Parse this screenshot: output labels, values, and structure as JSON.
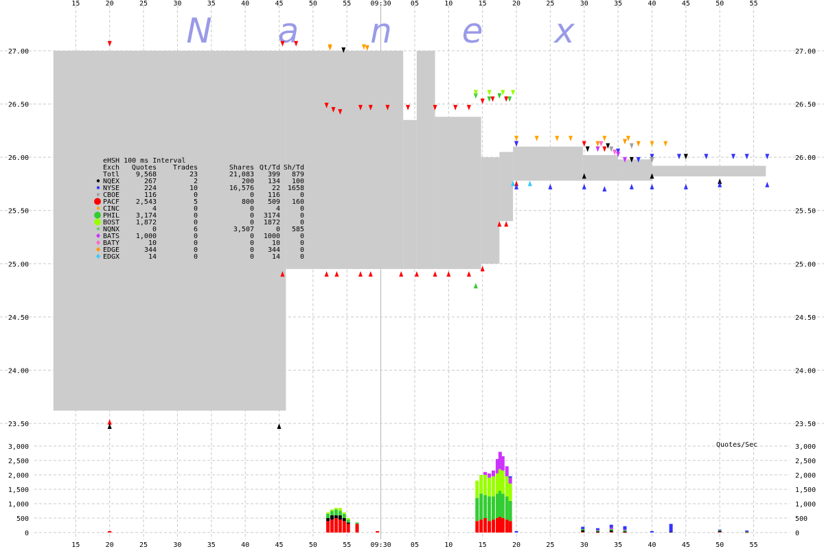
{
  "colors": {
    "background": "#ffffff",
    "grid": "#c8c8c8",
    "spread": "#cccccc",
    "watermark": "#9a9ae8",
    "NQEX": "#000000",
    "NYSE": "#3333ff",
    "CBOE": "#a0a0a0",
    "PACF": "#ff0000",
    "CINC": "#ffa500",
    "PHIL": "#33cc33",
    "BOST": "#99ff00",
    "NQNX": "#66cc66",
    "BATS": "#cc33ff",
    "BATY": "#ff66cc",
    "EDGE": "#ff9900",
    "EDGX": "#33ccff"
  },
  "watermark": [
    "N",
    "a",
    "n",
    "e",
    "x"
  ],
  "chart_data": [
    {
      "type": "area",
      "title": "",
      "xlabel": "",
      "ylabel": "",
      "x_unit": "minute",
      "x_ticks": [
        "15",
        "20",
        "25",
        "30",
        "35",
        "40",
        "45",
        "50",
        "55",
        "09:30",
        "05",
        "10",
        "15",
        "20",
        "25",
        "30",
        "35",
        "40",
        "45",
        "50",
        "55"
      ],
      "x_tick_minutes": [
        -15,
        -10,
        -5,
        0,
        5,
        10,
        15,
        20,
        25,
        30,
        35,
        40,
        45,
        50,
        55,
        60,
        65,
        70,
        75,
        80,
        85
      ],
      "x_range": [
        -20.3,
        89.5
      ],
      "highlight_time": "09:30",
      "highlight_minute": 30,
      "y_ticks": [
        "23.50",
        "24.00",
        "24.50",
        "25.00",
        "25.50",
        "26.00",
        "26.50",
        "27.00"
      ],
      "ylim": [
        23.5,
        27.0
      ],
      "grid": true,
      "spread": [
        {
          "x0": -18.3,
          "x1": 16.0,
          "low": 23.62,
          "high": 27.0
        },
        {
          "x0": 16.0,
          "x1": 33.3,
          "low": 24.95,
          "high": 27.0
        },
        {
          "x0": 33.3,
          "x1": 35.3,
          "low": 24.95,
          "high": 26.35
        },
        {
          "x0": 35.3,
          "x1": 38.0,
          "low": 24.95,
          "high": 27.0
        },
        {
          "x0": 38.0,
          "x1": 44.8,
          "low": 24.95,
          "high": 26.38
        },
        {
          "x0": 44.8,
          "x1": 47.5,
          "low": 25.0,
          "high": 26.0
        },
        {
          "x0": 47.5,
          "x1": 49.5,
          "low": 25.4,
          "high": 26.05
        },
        {
          "x0": 49.5,
          "x1": 59.8,
          "low": 25.78,
          "high": 26.1
        },
        {
          "x0": 59.8,
          "x1": 65.0,
          "low": 25.78,
          "high": 26.02
        },
        {
          "x0": 65.0,
          "x1": 70.0,
          "low": 25.78,
          "high": 25.98
        },
        {
          "x0": 70.0,
          "x1": 86.8,
          "low": 25.82,
          "high": 25.92
        }
      ],
      "series": [
        {
          "name": "PACF",
          "kind": "bid",
          "values": [
            [
              -10,
              23.54
            ],
            [
              15.5,
              24.93
            ],
            [
              22,
              24.93
            ],
            [
              23.5,
              24.93
            ],
            [
              27,
              24.93
            ],
            [
              28.5,
              24.93
            ],
            [
              33,
              24.93
            ],
            [
              35.3,
              24.93
            ],
            [
              38,
              24.93
            ],
            [
              40,
              24.93
            ],
            [
              43,
              24.93
            ],
            [
              45,
              24.98
            ],
            [
              47.5,
              25.4
            ],
            [
              48.5,
              25.4
            ],
            [
              50,
              25.78
            ]
          ]
        },
        {
          "name": "PACF",
          "kind": "ask",
          "values": [
            [
              -10,
              27.04
            ],
            [
              15.5,
              27.04
            ],
            [
              17.5,
              27.04
            ],
            [
              22,
              26.46
            ],
            [
              23,
              26.42
            ],
            [
              24,
              26.4
            ],
            [
              27,
              26.44
            ],
            [
              28.5,
              26.44
            ],
            [
              31,
              26.44
            ],
            [
              34,
              26.44
            ],
            [
              38,
              26.44
            ],
            [
              41,
              26.44
            ],
            [
              43,
              26.44
            ],
            [
              45,
              26.5
            ],
            [
              46.5,
              26.52
            ],
            [
              48.5,
              26.52
            ],
            [
              50,
              26.1
            ],
            [
              60,
              26.1
            ],
            [
              63,
              26.05
            ]
          ]
        },
        {
          "name": "NQEX",
          "kind": "bid",
          "values": [
            [
              -10,
              23.5
            ],
            [
              15,
              23.5
            ],
            [
              60,
              25.85
            ],
            [
              70,
              25.85
            ],
            [
              80,
              25.8
            ]
          ]
        },
        {
          "name": "NQEX",
          "kind": "ask",
          "values": [
            [
              24.5,
              26.98
            ],
            [
              60.5,
              26.05
            ],
            [
              63.5,
              26.08
            ],
            [
              67,
              25.95
            ],
            [
              70,
              25.95
            ],
            [
              75,
              25.98
            ]
          ]
        },
        {
          "name": "NYSE",
          "kind": "bid",
          "values": [
            [
              50,
              25.75
            ],
            [
              55,
              25.75
            ],
            [
              60,
              25.75
            ],
            [
              63,
              25.73
            ],
            [
              67,
              25.75
            ],
            [
              70,
              25.75
            ],
            [
              75,
              25.75
            ],
            [
              80,
              25.77
            ],
            [
              87,
              25.77
            ]
          ]
        },
        {
          "name": "NYSE",
          "kind": "ask",
          "values": [
            [
              50,
              26.1
            ],
            [
              65,
              26.03
            ],
            [
              68,
              25.95
            ],
            [
              70,
              25.98
            ],
            [
              74,
              25.98
            ],
            [
              78,
              25.98
            ],
            [
              82,
              25.98
            ],
            [
              84,
              25.98
            ],
            [
              87,
              25.98
            ]
          ]
        },
        {
          "name": "PHIL",
          "kind": "ask",
          "values": [
            [
              44,
              26.55
            ],
            [
              46,
              26.52
            ],
            [
              47.5,
              26.55
            ],
            [
              49,
              26.52
            ]
          ]
        },
        {
          "name": "PHIL",
          "kind": "bid",
          "values": [
            [
              44,
              24.82
            ]
          ]
        },
        {
          "name": "BOST",
          "kind": "ask",
          "values": [
            [
              44,
              26.58
            ],
            [
              46,
              26.58
            ],
            [
              48,
              26.58
            ],
            [
              49.5,
              26.58
            ]
          ]
        },
        {
          "name": "CINC",
          "kind": "ask",
          "values": [
            [
              22.5,
              27.01
            ],
            [
              27.5,
              27.01
            ],
            [
              50,
              26.15
            ],
            [
              53,
              26.15
            ],
            [
              56,
              26.15
            ],
            [
              58,
              26.15
            ],
            [
              63,
              26.15
            ],
            [
              66.5,
              26.15
            ],
            [
              70,
              26.1
            ],
            [
              72,
              26.1
            ]
          ]
        },
        {
          "name": "BATS",
          "kind": "ask",
          "values": [
            [
              62,
              26.05
            ],
            [
              65,
              26.0
            ],
            [
              66,
              25.95
            ]
          ]
        },
        {
          "name": "BATY",
          "kind": "ask",
          "values": [
            [
              62.5,
              26.1
            ],
            [
              64.5,
              26.02
            ]
          ]
        },
        {
          "name": "CBOE",
          "kind": "ask",
          "values": [
            [
              64,
              26.05
            ],
            [
              67,
              26.08
            ],
            [
              70,
              25.95
            ]
          ]
        },
        {
          "name": "EDGE",
          "kind": "ask",
          "values": [
            [
              22.5,
              27.0
            ],
            [
              28,
              27.0
            ],
            [
              62,
              26.1
            ],
            [
              66,
              26.12
            ],
            [
              68,
              26.1
            ]
          ]
        },
        {
          "name": "EDGX",
          "kind": "bid",
          "values": [
            [
              49.5,
              25.78
            ],
            [
              52,
              25.78
            ]
          ]
        }
      ]
    },
    {
      "type": "bar",
      "title": "Quotes/Sec",
      "xlabel": "",
      "ylabel": "",
      "x_unit": "minute",
      "y_ticks": [
        "0",
        "500",
        "1,000",
        "1,500",
        "2,000",
        "2,500",
        "3,000"
      ],
      "ylim": [
        0,
        3000
      ],
      "grid": true,
      "stack_order": [
        "PACF",
        "NQEX",
        "PHIL",
        "BOST",
        "BATS",
        "NYSE"
      ],
      "bins": [
        {
          "x": -10,
          "PACF": 50,
          "NQEX": 0,
          "PHIL": 0,
          "BOST": 0,
          "BATS": 0,
          "NYSE": 0
        },
        {
          "x": 22.2,
          "PACF": 400,
          "NQEX": 100,
          "PHIL": 150,
          "BOST": 50,
          "BATS": 0,
          "NYSE": 0
        },
        {
          "x": 22.8,
          "PACF": 450,
          "NQEX": 150,
          "PHIL": 150,
          "BOST": 50,
          "BATS": 0,
          "NYSE": 0
        },
        {
          "x": 23.4,
          "PACF": 500,
          "NQEX": 100,
          "PHIL": 200,
          "BOST": 50,
          "BATS": 0,
          "NYSE": 0
        },
        {
          "x": 24.0,
          "PACF": 450,
          "NQEX": 150,
          "PHIL": 150,
          "BOST": 100,
          "BATS": 0,
          "NYSE": 0
        },
        {
          "x": 24.6,
          "PACF": 400,
          "NQEX": 100,
          "PHIL": 150,
          "BOST": 50,
          "BATS": 0,
          "NYSE": 0
        },
        {
          "x": 25.2,
          "PACF": 300,
          "NQEX": 50,
          "PHIL": 100,
          "BOST": 50,
          "BATS": 0,
          "NYSE": 0
        },
        {
          "x": 26.5,
          "PACF": 300,
          "NQEX": 0,
          "PHIL": 50,
          "BOST": 0,
          "BATS": 0,
          "NYSE": 0
        },
        {
          "x": 29.5,
          "PACF": 50,
          "NQEX": 0,
          "PHIL": 0,
          "BOST": 0,
          "BATS": 0,
          "NYSE": 0
        },
        {
          "x": 44.2,
          "PACF": 400,
          "NQEX": 0,
          "PHIL": 800,
          "BOST": 600,
          "BATS": 0,
          "NYSE": 0
        },
        {
          "x": 44.8,
          "PACF": 450,
          "NQEX": 0,
          "PHIL": 900,
          "BOST": 650,
          "BATS": 0,
          "NYSE": 0
        },
        {
          "x": 45.4,
          "PACF": 500,
          "NQEX": 0,
          "PHIL": 800,
          "BOST": 700,
          "BATS": 100,
          "NYSE": 0
        },
        {
          "x": 46.0,
          "PACF": 400,
          "NQEX": 0,
          "PHIL": 850,
          "BOST": 650,
          "BATS": 150,
          "NYSE": 0
        },
        {
          "x": 46.6,
          "PACF": 450,
          "NQEX": 0,
          "PHIL": 800,
          "BOST": 700,
          "BATS": 200,
          "NYSE": 0
        },
        {
          "x": 47.2,
          "PACF": 500,
          "NQEX": 0,
          "PHIL": 850,
          "BOST": 700,
          "BATS": 500,
          "NYSE": 0
        },
        {
          "x": 47.6,
          "PACF": 550,
          "NQEX": 0,
          "PHIL": 900,
          "BOST": 750,
          "BATS": 600,
          "NYSE": 0
        },
        {
          "x": 48.0,
          "PACF": 500,
          "NQEX": 0,
          "PHIL": 850,
          "BOST": 800,
          "BATS": 500,
          "NYSE": 0
        },
        {
          "x": 48.6,
          "PACF": 450,
          "NQEX": 0,
          "PHIL": 800,
          "BOST": 700,
          "BATS": 350,
          "NYSE": 0
        },
        {
          "x": 49.1,
          "PACF": 400,
          "NQEX": 0,
          "PHIL": 700,
          "BOST": 600,
          "BATS": 200,
          "NYSE": 50
        },
        {
          "x": 50.0,
          "PACF": 0,
          "NQEX": 0,
          "PHIL": 0,
          "BOST": 0,
          "BATS": 0,
          "NYSE": 50
        },
        {
          "x": 59.8,
          "PACF": 20,
          "NQEX": 60,
          "PHIL": 40,
          "BOST": 0,
          "BATS": 0,
          "NYSE": 80
        },
        {
          "x": 62.0,
          "PACF": 10,
          "NQEX": 30,
          "PHIL": 30,
          "BOST": 0,
          "BATS": 20,
          "NYSE": 60
        },
        {
          "x": 64.0,
          "PACF": 20,
          "NQEX": 50,
          "PHIL": 50,
          "BOST": 0,
          "BATS": 50,
          "NYSE": 100
        },
        {
          "x": 66.0,
          "PACF": 10,
          "NQEX": 30,
          "PHIL": 40,
          "BOST": 0,
          "BATS": 20,
          "NYSE": 120
        },
        {
          "x": 70.0,
          "PACF": 0,
          "NQEX": 0,
          "PHIL": 0,
          "BOST": 0,
          "BATS": 0,
          "NYSE": 50
        },
        {
          "x": 72.8,
          "PACF": 0,
          "NQEX": 20,
          "PHIL": 0,
          "BOST": 0,
          "BATS": 0,
          "NYSE": 280
        },
        {
          "x": 80.0,
          "PACF": 20,
          "NQEX": 30,
          "PHIL": 20,
          "BOST": 0,
          "BATS": 0,
          "NYSE": 30
        },
        {
          "x": 84.0,
          "PACF": 10,
          "NQEX": 10,
          "PHIL": 10,
          "BOST": 0,
          "BATS": 0,
          "NYSE": 40
        }
      ]
    }
  ],
  "stats": {
    "title": "eHSH 100 ms Interval",
    "columns": [
      "Exch",
      "Quotes",
      "Trades",
      "Shares",
      "Qt/Td",
      "Sh/Td"
    ],
    "rows": [
      {
        "exch": "Totl",
        "quotes": "9,568",
        "trades": "23",
        "shares": "21,083",
        "qt_td": "399",
        "sh_td": "879",
        "marker": "none",
        "color": ""
      },
      {
        "exch": "NQEX",
        "quotes": "267",
        "trades": "2",
        "shares": "200",
        "qt_td": "134",
        "sh_td": "100",
        "marker": "dot",
        "color": "#000000"
      },
      {
        "exch": "NYSE",
        "quotes": "224",
        "trades": "10",
        "shares": "16,576",
        "qt_td": "22",
        "sh_td": "1658",
        "marker": "dot",
        "color": "#3333ff"
      },
      {
        "exch": "CBOE",
        "quotes": "116",
        "trades": "0",
        "shares": "0",
        "qt_td": "116",
        "sh_td": "0",
        "marker": "dot",
        "color": "#a0a0a0"
      },
      {
        "exch": "PACF",
        "quotes": "2,543",
        "trades": "5",
        "shares": "800",
        "qt_td": "509",
        "sh_td": "160",
        "marker": "big",
        "color": "#ff0000"
      },
      {
        "exch": "CINC",
        "quotes": "4",
        "trades": "0",
        "shares": "0",
        "qt_td": "4",
        "sh_td": "0",
        "marker": "dot",
        "color": "#ffa500"
      },
      {
        "exch": "PHIL",
        "quotes": "3,174",
        "trades": "0",
        "shares": "0",
        "qt_td": "3174",
        "sh_td": "0",
        "marker": "big",
        "color": "#33cc33"
      },
      {
        "exch": "BOST",
        "quotes": "1,872",
        "trades": "0",
        "shares": "0",
        "qt_td": "1872",
        "sh_td": "0",
        "marker": "big",
        "color": "#99ff00"
      },
      {
        "exch": "NQNX",
        "quotes": "0",
        "trades": "6",
        "shares": "3,507",
        "qt_td": "0",
        "sh_td": "585",
        "marker": "dot",
        "color": "#66cc66"
      },
      {
        "exch": "BATS",
        "quotes": "1,000",
        "trades": "0",
        "shares": "0",
        "qt_td": "1000",
        "sh_td": "0",
        "marker": "diamond",
        "color": "#cc33ff"
      },
      {
        "exch": "BATY",
        "quotes": "10",
        "trades": "0",
        "shares": "0",
        "qt_td": "10",
        "sh_td": "0",
        "marker": "diamond",
        "color": "#ff66cc"
      },
      {
        "exch": "EDGE",
        "quotes": "344",
        "trades": "0",
        "shares": "0",
        "qt_td": "344",
        "sh_td": "0",
        "marker": "diamond",
        "color": "#ff9900"
      },
      {
        "exch": "EDGX",
        "quotes": "14",
        "trades": "0",
        "shares": "0",
        "qt_td": "14",
        "sh_td": "0",
        "marker": "diamond",
        "color": "#33ccff"
      }
    ]
  }
}
